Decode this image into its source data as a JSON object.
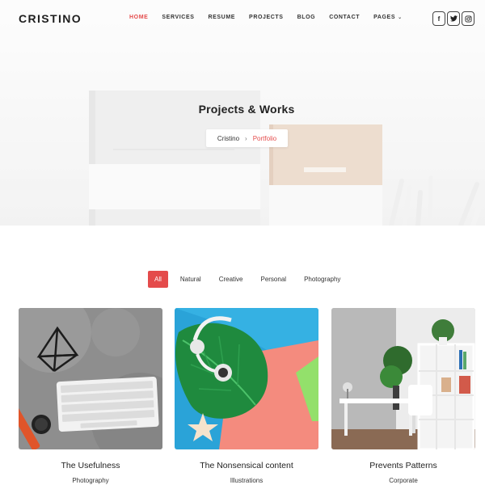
{
  "brand": {
    "logo_text": "CRISTINO"
  },
  "nav": {
    "items": [
      {
        "label": "HOME",
        "active": true
      },
      {
        "label": "SERVICES",
        "active": false
      },
      {
        "label": "RESUME",
        "active": false
      },
      {
        "label": "PROJECTS",
        "active": false
      },
      {
        "label": "BLOG",
        "active": false
      },
      {
        "label": "CONTACT",
        "active": false
      },
      {
        "label": "PAGES",
        "active": false
      }
    ]
  },
  "socials": [
    {
      "icon": "facebook-icon",
      "glyph": "f"
    },
    {
      "icon": "twitter-icon",
      "glyph": "t"
    },
    {
      "icon": "instagram-icon",
      "glyph": "◎"
    }
  ],
  "hero": {
    "title": "Projects & Works",
    "breadcrumb": {
      "home": "Cristino",
      "current": "Portfolio"
    }
  },
  "filters": [
    "All",
    "Natural",
    "Creative",
    "Personal",
    "Photography"
  ],
  "active_filter": "All",
  "projects": [
    {
      "title": "The Usefulness",
      "category": "Photography"
    },
    {
      "title": "The Nonsensical content",
      "category": "Illustrations"
    },
    {
      "title": "Prevents Patterns",
      "category": "Corporate"
    }
  ],
  "colors": {
    "accent": "#e44b4b",
    "text": "#222222"
  }
}
